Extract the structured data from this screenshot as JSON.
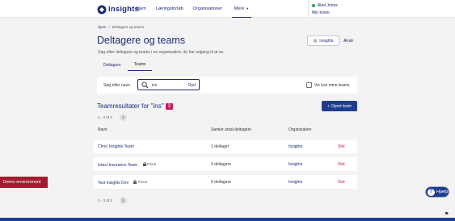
{
  "brand": {
    "logo_text": "insights"
  },
  "nav": {
    "items": [
      {
        "label": "Hjem"
      },
      {
        "label": "Læringsforløb"
      },
      {
        "label": "Organisationer"
      }
    ],
    "more_label": "Mere",
    "more_caret": "▼"
  },
  "user": {
    "name": "Aled Jones",
    "account_link": "Min konto"
  },
  "breadcrumb": {
    "home": "Hjem",
    "separator": "/",
    "current": "Deltagere og teams"
  },
  "page": {
    "title": "Deltagere og teams",
    "subtitle": "Søg efter deltagere og teams i en organisation, du har adgang til at se."
  },
  "org_selector": {
    "label": "Insights",
    "change_label": "Ændr"
  },
  "tabs": [
    {
      "label": "Deltagere"
    },
    {
      "label": "Teams"
    }
  ],
  "search": {
    "label": "Søg efter navn",
    "value": "ins",
    "clear_label": "Ryd",
    "checkbox_label": "Vis kun mine teams"
  },
  "results": {
    "title": "Teamresultater for \"ins\"",
    "count": "3",
    "create_label": "Opret team",
    "create_plus": "+",
    "pager_text": "1 - 3 of 3",
    "page_number": "1"
  },
  "table": {
    "headers": {
      "name": "Navn",
      "members": "Samlet antal deltagere",
      "org": "Organisation"
    },
    "rows": [
      {
        "name": "Chris' Insights Team",
        "private": "",
        "members": "1 deltager",
        "org": "Insights",
        "action": "Slet"
      },
      {
        "name": "Intact Insurance Team",
        "private": "Privat",
        "members": "3 deltagere",
        "org": "Insights",
        "action": "Slet"
      },
      {
        "name": "Test Insights Dov",
        "private": "Privat",
        "members": "0 deltagere",
        "org": "Insights",
        "action": "Slet"
      }
    ]
  },
  "demo_banner": "Demo environment",
  "help": {
    "label": "Hjælp",
    "symbol": "?"
  },
  "icons": {
    "lock": "lock-icon",
    "search": "search-icon",
    "flag": "flag-icon"
  },
  "colors": {
    "primary": "#1e2a78",
    "accent_button": "#1e3d8f",
    "badge": "#c8185a",
    "banner": "#a11c2f",
    "status": "#1ba65a"
  }
}
